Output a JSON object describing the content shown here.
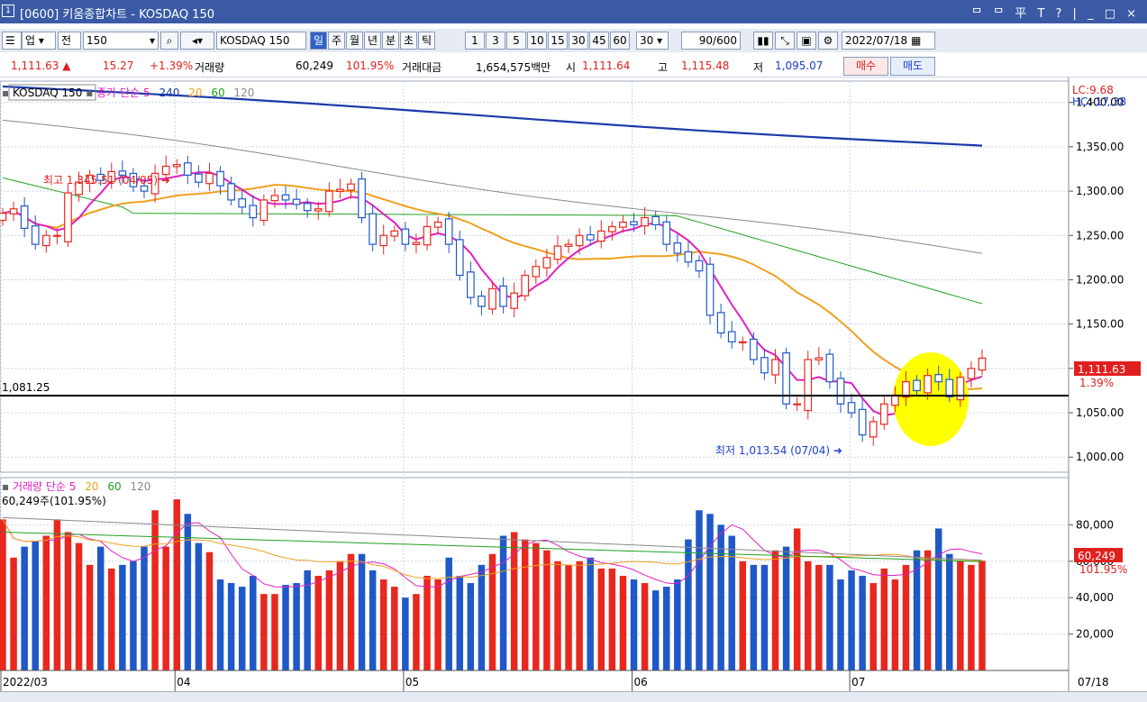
{
  "window": {
    "icon": "1",
    "title": "[0600] 키움종합차트 - KOSDAQ 150",
    "controls": "ᄆ ᄆ 平 T ? | _ □ ×"
  },
  "toolbar": {
    "market": "업",
    "range_mode": "전",
    "code": "150",
    "symbol": "KOSDAQ 150",
    "periods": [
      "일",
      "주",
      "월",
      "년",
      "분",
      "초",
      "틱"
    ],
    "active_period": "일",
    "intervals": [
      "1",
      "3",
      "5",
      "10",
      "15",
      "30",
      "45",
      "60"
    ],
    "interval_value": "30",
    "count": "90",
    "count_total": "/600",
    "date": "2022/07/18"
  },
  "quote": {
    "price": "1,111.63 ▲",
    "change": "15.27",
    "change_pct": "+1.39%",
    "volume_label": "거래량",
    "volume": "60,249",
    "volume_pct": "101.95%",
    "amount_label": "거래대금",
    "amount": "1,654,575백만",
    "open_label": "시",
    "open": "1,111.64",
    "high_label": "고",
    "high": "1,115.48",
    "low_label": "저",
    "low": "1,095.07",
    "buy_label": "매수",
    "sell_label": "매도"
  },
  "legend_price": {
    "name": "KOSDAQ 150",
    "items": [
      "종가 단순 5",
      "240",
      "20",
      "60",
      "120"
    ]
  },
  "legend_volume": {
    "items": [
      "거래량 단순 5",
      "20",
      "60",
      "120"
    ],
    "value": "60,249주(101.95%)"
  },
  "axis": {
    "lc": "LC:9.68",
    "hc": "HC:-17.38",
    "current_price": "1,111.63",
    "current_pct": "1.39%",
    "vol_current": "60,249",
    "vol_pct": "101.95%",
    "end_date": "07/18",
    "line_value": "1,081.25"
  },
  "annotations": {
    "high": "최고 1,345.51 (04/05)",
    "low": "최저 1,013.54 (07/04)"
  },
  "colors": {
    "up": "#e8281e",
    "down": "#1f58c8",
    "ma5": "#e020c0",
    "ma20": "#f0a020",
    "ma60": "#20a020",
    "ma120": "#888888",
    "ma240": "#1a3aa8",
    "highlight": "#ffff00"
  },
  "chart_data": [
    {
      "type": "candlestick",
      "title": "KOSDAQ 150",
      "ylim": [
        985,
        1420
      ],
      "yticks": [
        "1,400.00",
        "1,350.00",
        "1,300.00",
        "1,250.00",
        "1,200.00",
        "1,150.00",
        "1,100.00",
        "1,050.00",
        "1,000.00"
      ],
      "ytick_values": [
        1400,
        1350,
        1300,
        1250,
        1200,
        1150,
        1100,
        1050,
        1000
      ],
      "x_months": [
        {
          "label": "2022/03",
          "index": 0
        },
        {
          "label": "04",
          "index": 16
        },
        {
          "label": "05",
          "index": 37
        },
        {
          "label": "06",
          "index": 58
        },
        {
          "label": "07",
          "index": 78
        }
      ],
      "horizontal_line": 1081.25,
      "close": [
        1275,
        1280,
        1258,
        1240,
        1250,
        1250,
        1298,
        1310,
        1318,
        1312,
        1322,
        1318,
        1305,
        1300,
        1320,
        1328,
        1330,
        1318,
        1310,
        1320,
        1306,
        1290,
        1282,
        1270,
        1290,
        1295,
        1290,
        1285,
        1278,
        1280,
        1300,
        1302,
        1308,
        1270,
        1240,
        1250,
        1255,
        1240,
        1242,
        1260,
        1265,
        1240,
        1205,
        1180,
        1170,
        1190,
        1170,
        1185,
        1205,
        1215,
        1225,
        1238,
        1240,
        1250,
        1245,
        1255,
        1260,
        1265,
        1262,
        1270,
        1262,
        1240,
        1230,
        1220,
        1210,
        1160,
        1140,
        1130,
        1130,
        1110,
        1095,
        1110,
        1060,
        1060,
        1110,
        1112,
        1085,
        1060,
        1050,
        1025,
        1040,
        1060,
        1070,
        1085,
        1075,
        1092,
        1085,
        1068,
        1090,
        1100,
        1111.63
      ],
      "volume_k": [
        83,
        62,
        68,
        71,
        74,
        83,
        76,
        70,
        58,
        68,
        56,
        58,
        60,
        68,
        88,
        68,
        94,
        86,
        70,
        65,
        50,
        48,
        46,
        52,
        42,
        42,
        47,
        48,
        55,
        52,
        55,
        60,
        64,
        64,
        55,
        50,
        46,
        40,
        42,
        52,
        50,
        62,
        52,
        48,
        58,
        64,
        74,
        76,
        72,
        70,
        66,
        60,
        58,
        60,
        62,
        56,
        56,
        52,
        50,
        48,
        44,
        46,
        50,
        72,
        88,
        86,
        80,
        74,
        60,
        58,
        58,
        66,
        68,
        78,
        60,
        58,
        58,
        50,
        55,
        52,
        48,
        56,
        50,
        58,
        66,
        66,
        78,
        64,
        60,
        58,
        60.249
      ],
      "ma_last": {
        "ma240": 1351,
        "ma120": 1228,
        "ma60": 1173,
        "ma20": 1080,
        "ma5": 1096
      },
      "vol_yticks": [
        "80,000",
        "60,000",
        "40,000",
        "20,000"
      ],
      "vol_ytick_values": [
        80,
        60,
        40,
        20
      ]
    }
  ]
}
